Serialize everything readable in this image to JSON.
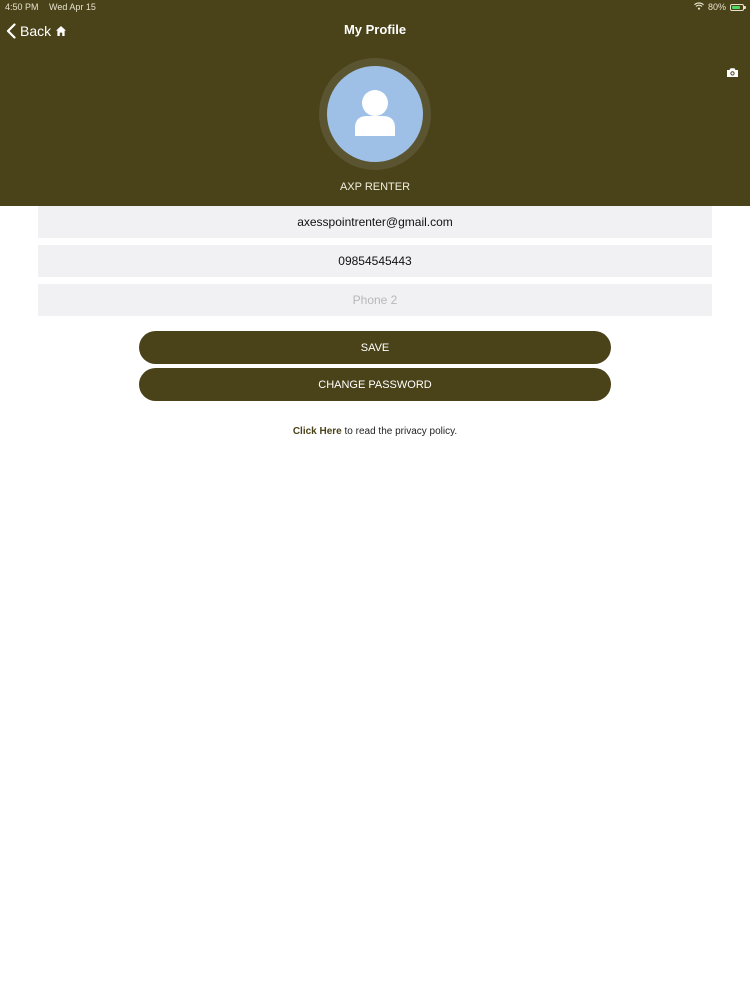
{
  "status_bar": {
    "time": "4:50 PM",
    "date": "Wed Apr 15",
    "battery_percent_label": "80%",
    "battery_level": 0.8,
    "icons": [
      "wifi-icon",
      "battery-icon"
    ]
  },
  "nav": {
    "back_label": "Back",
    "title": "My Profile",
    "icons": [
      "chevron-left-icon",
      "home-icon",
      "camera-icon"
    ]
  },
  "profile": {
    "name": "AXP RENTER",
    "avatar_icon": "user-icon"
  },
  "form": {
    "email_value": "axesspointrenter@gmail.com",
    "phone_value": "09854545443",
    "phone2_value": "",
    "phone2_placeholder": "Phone 2"
  },
  "buttons": {
    "save_label": "SAVE",
    "change_password_label": "CHANGE PASSWORD"
  },
  "privacy": {
    "link_text": "Click Here",
    "rest_text": " to read the privacy policy."
  },
  "colors": {
    "header_bg": "#4a4218",
    "avatar_bg": "#9ec0e7",
    "field_bg": "#f1f1f4",
    "battery_green": "#4cd964"
  }
}
